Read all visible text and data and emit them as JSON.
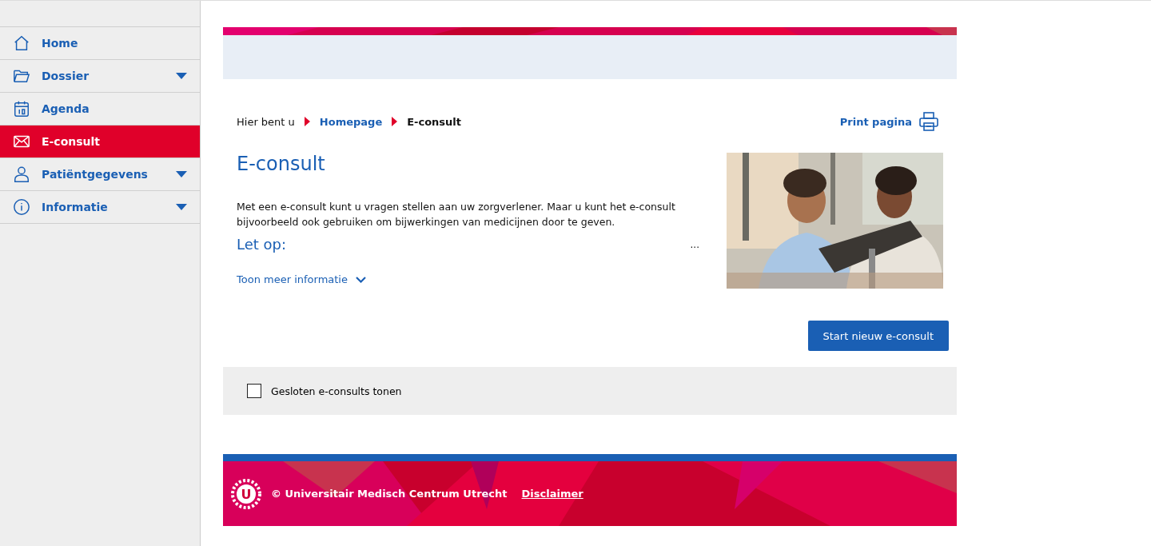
{
  "sidebar": {
    "items": [
      {
        "label": "Home",
        "kind": "home",
        "selected": false,
        "has_submenu": false
      },
      {
        "label": "Dossier",
        "kind": "folder",
        "selected": false,
        "has_submenu": true
      },
      {
        "label": "Agenda",
        "kind": "calendar",
        "selected": false,
        "has_submenu": false
      },
      {
        "label": "E-consult",
        "kind": "mail",
        "selected": true,
        "has_submenu": false
      },
      {
        "label": "Patiëntgegevens",
        "kind": "user",
        "selected": false,
        "has_submenu": true
      },
      {
        "label": "Informatie",
        "kind": "info",
        "selected": false,
        "has_submenu": true
      }
    ]
  },
  "breadcrumb": {
    "prefix": "Hier bent u",
    "items": [
      {
        "label": "Homepage",
        "current": false
      },
      {
        "label": "E-consult",
        "current": true
      }
    ]
  },
  "print": {
    "label": "Print pagina"
  },
  "page": {
    "title": "E-consult",
    "intro": "Met een e-consult kunt u vragen stellen aan uw zorgverlener. Maar u kunt het e-consult bijvoorbeeld ook gebruiken om bijwerkingen van medicijnen door te geven.",
    "notice_title": "Let op:",
    "ellipsis": "...",
    "more_link": "Toon meer informatie"
  },
  "start_button": "Start nieuw e-consult",
  "filter": {
    "label": "Gesloten e-consults tonen",
    "checked": false
  },
  "footer": {
    "logo_letter": "U",
    "copyright": "© Universitair Medisch Centrum Utrecht",
    "link": "Disclaimer"
  }
}
